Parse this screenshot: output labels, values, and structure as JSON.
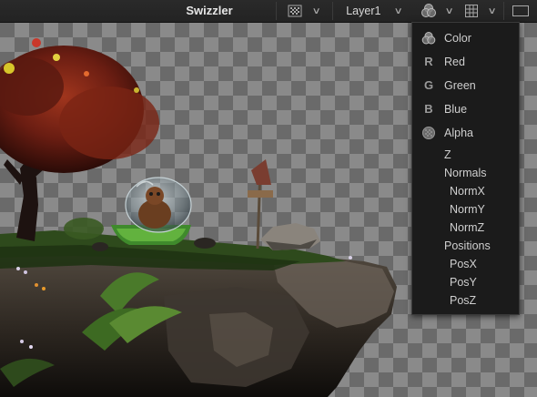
{
  "toolbar": {
    "title": "Swizzler",
    "layer_label": "Layer1"
  },
  "channel_menu": {
    "items": [
      {
        "label": "Color",
        "icon": "color-channels-icon"
      },
      {
        "label": "Red",
        "icon": "R"
      },
      {
        "label": "Green",
        "icon": "G"
      },
      {
        "label": "Blue",
        "icon": "B"
      },
      {
        "label": "Alpha",
        "icon": "alpha-icon"
      },
      {
        "label": "Z"
      },
      {
        "label": "Normals"
      },
      {
        "label": "NormX"
      },
      {
        "label": "NormY"
      },
      {
        "label": "NormZ"
      },
      {
        "label": "Positions"
      },
      {
        "label": "PosX"
      },
      {
        "label": "PosY"
      },
      {
        "label": "PosZ"
      }
    ]
  },
  "colors": {
    "toolbar_bg": "#262626",
    "menu_bg": "#1b1b1b",
    "checker_dark": "#6a6a6a",
    "checker_light": "#8a8a8a"
  }
}
